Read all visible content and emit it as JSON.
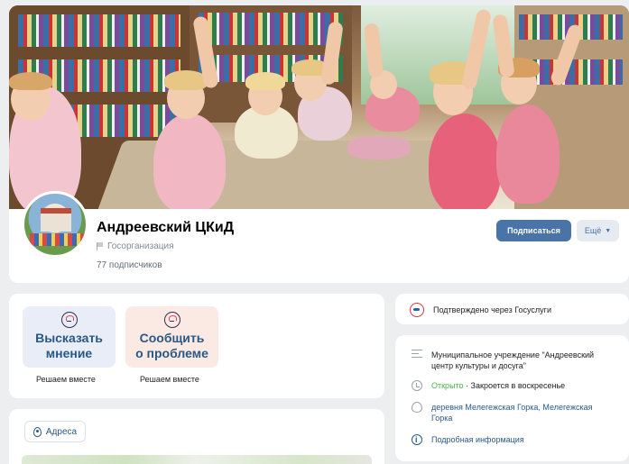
{
  "profile": {
    "name": "Андреевский ЦКиД",
    "org_type": "Госорганизация",
    "subscribers": "77 подписчиков"
  },
  "header_actions": {
    "subscribe_label": "Подписаться",
    "more_label": "Ещё"
  },
  "actions": [
    {
      "label_line1": "Высказать",
      "label_line2": "мнение",
      "caption": "Решаем вместе"
    },
    {
      "label_line1": "Сообщить",
      "label_line2": "о проблеме",
      "caption": "Решаем вместе"
    }
  ],
  "addresses": {
    "label": "Адреса"
  },
  "verification": {
    "text": "Подтверждено через Госуслуги"
  },
  "info": {
    "description_line1": "Муниципальное учреждение \"Андреевский",
    "description_line2": "центр культуры и досуга\"",
    "status_open": "Открыто",
    "status_rest": " · Закроется в воскресенье",
    "address_line1": "деревня Мелегежская Горка, Мелегежская",
    "address_line2": "Горка",
    "details_link": "Подробная информация"
  },
  "colors": {
    "accent": "#4a74a8",
    "link": "#2a5885",
    "open_status": "#4bb34b",
    "background": "#edeef0"
  },
  "icons": [
    "flag-icon",
    "chevron-down-icon",
    "mouth-icon",
    "location-pin-icon",
    "gosuslugi-icon",
    "lines-icon",
    "clock-icon",
    "info-icon"
  ]
}
